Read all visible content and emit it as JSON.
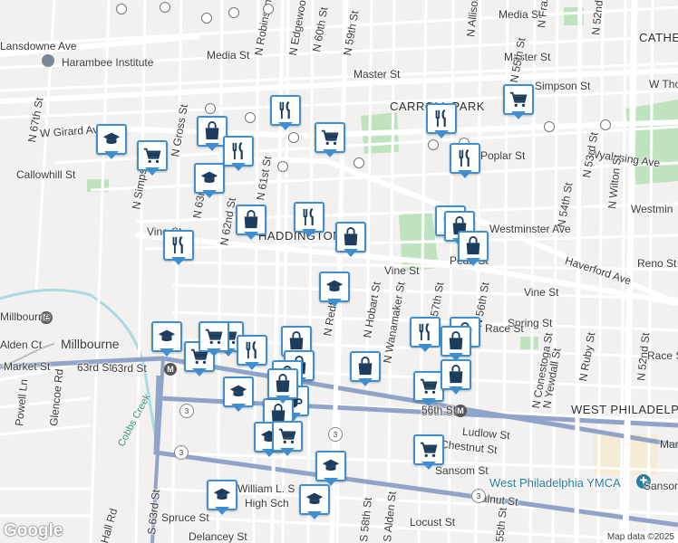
{
  "map": {
    "parks": [
      "park-1",
      "park-2",
      "park-3",
      "park-4",
      "park-5"
    ],
    "area_labels": [
      "CARROLL PARK",
      "HADDINGTON",
      "WEST PHILADELPHIA",
      "CATHE"
    ],
    "place_labels": [
      "Harambee Institute",
      "Millbourne",
      "West Philadelphia YMCA",
      "William L. S",
      "High Sch"
    ],
    "street_labels": [
      "Lansdowne Ave",
      "Master St",
      "Master St",
      "Media St",
      "Media St",
      "W Girard Ave",
      "Callowhill St",
      "Vine St",
      "Vine St",
      "Vine St",
      "Westminster Ave",
      "Westmin",
      "Haverford Ave",
      "Pearl St",
      "Reno St",
      "Spring St",
      "Race St",
      "Race St",
      "Market St",
      "Mark",
      "Ludlow St",
      "Chestnut St",
      "Sansom St",
      "Sansom St",
      "Walnut St",
      "Spruce St",
      "Locust St",
      "Delancey St",
      "Poplar St",
      "Wyalusing Ave",
      "W Thom",
      "Simpson St",
      "N 67th St",
      "N Gross St",
      "N Simpson St",
      "N 63rd St",
      "N 62nd St",
      "N 61st St",
      "N Robinson St",
      "N Edgewood St",
      "N 60th St",
      "N 59th St",
      "N Redfield St",
      "N Hobart St",
      "N Wanamaker St",
      "N 57th St",
      "N 56th St",
      "N 55th St",
      "N 54th St",
      "N 53rd St",
      "N 52nd St",
      "N 52nd St",
      "N Wilton St",
      "N Conestoga St",
      "N Yewdall St",
      "N Ruby St",
      "S 63rd St",
      "S 58th St",
      "S Alden St",
      "55th St",
      "Powell Ln",
      "Glencoe Rd",
      "Alden Ct",
      "Hall Rd",
      "N Allison St",
      "N Frazier St",
      "63rd St",
      "56th St",
      "Cobbs Creek"
    ],
    "transit": [
      "Millbourne",
      "63rd St",
      "56th St"
    ],
    "route_shields": [
      "3",
      "3",
      "3",
      "3"
    ],
    "markers": [
      "school",
      "grocery",
      "shop",
      "restaurant",
      "school",
      "grocery",
      "restaurant",
      "shop",
      "grocery",
      "restaurant",
      "restaurant",
      "school",
      "grocery",
      "shop",
      "restaurant",
      "shop",
      "shop",
      "shop",
      "school",
      "grocery",
      "restaurant",
      "grocery",
      "grocery",
      "restaurant",
      "shop",
      "shop",
      "shop",
      "shop",
      "grocery",
      "shop",
      "coffee",
      "shop",
      "school",
      "shop",
      "school",
      "grocery",
      "school",
      "school",
      "school",
      "shop",
      "shop",
      "restaurant"
    ]
  },
  "google_logo": "Google",
  "attribution": "Map data ©2025",
  "colors": {
    "pin_border": "#3f8fd0",
    "pin_icon": "#1d3d5c",
    "park": "#bfe3bf",
    "road": "#ffffff",
    "major_road": "#8fa4c8",
    "water": "#a8dbe4"
  }
}
